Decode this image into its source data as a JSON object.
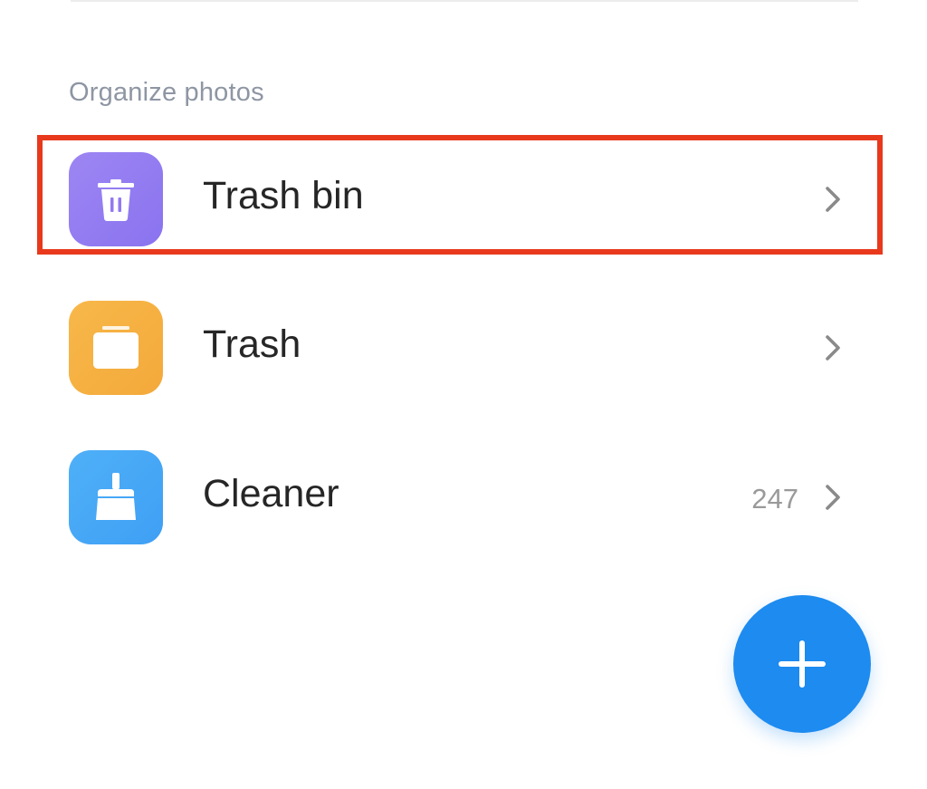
{
  "section": {
    "title": "Organize photos"
  },
  "items": [
    {
      "label": "Trash bin",
      "icon": "trash-can-icon",
      "count": "",
      "color": "#9479f1",
      "highlighted": true
    },
    {
      "label": "Trash",
      "icon": "folder-tray-icon",
      "count": "",
      "color": "#f5af40",
      "highlighted": false
    },
    {
      "label": "Cleaner",
      "icon": "broom-icon",
      "count": "247",
      "color": "#45a6f6",
      "highlighted": false
    }
  ],
  "fab": {
    "icon": "plus-icon",
    "color": "#1d8bf0"
  },
  "highlight_color": "#e8391d"
}
